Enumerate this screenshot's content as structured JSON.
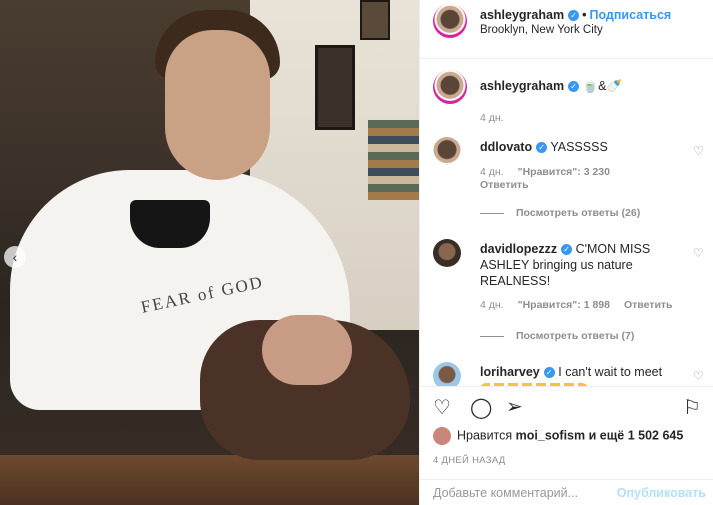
{
  "photo": {
    "shirt_text": "FEAR of GOD",
    "nav_prev_icon": "‹"
  },
  "header": {
    "username": "ashleygraham",
    "follow_label": "Подписаться",
    "location": "Brooklyn, New York City"
  },
  "caption": {
    "username": "ashleygraham",
    "text": "🍵&🍼",
    "time": "4 дн."
  },
  "comments": [
    {
      "username": "ddlovato",
      "text": "YASSSSS",
      "time": "4 дн.",
      "likes": "\"Нравится\": 3 230",
      "reply_label": "Ответить",
      "view_replies": "Посмотреть ответы (26)"
    },
    {
      "username": "davidlopezzz",
      "text": "C'MON MISS ASHLEY bringing us nature REALNESS!",
      "time": "4 дн.",
      "likes": "\"Нравится\": 1 898",
      "reply_label": "Ответить",
      "view_replies": "Посмотреть ответы (7)"
    },
    {
      "username": "loriharvey",
      "text": "I can't wait to meet"
    }
  ],
  "likes": {
    "prefix": "Нравится",
    "user": "moi_sofism",
    "suffix": "и ещё 1 502 645"
  },
  "date": "4 ДНЕЙ НАЗАД",
  "add_comment": {
    "placeholder": "Добавьте комментарий...",
    "publish_label": "Опубликовать"
  }
}
